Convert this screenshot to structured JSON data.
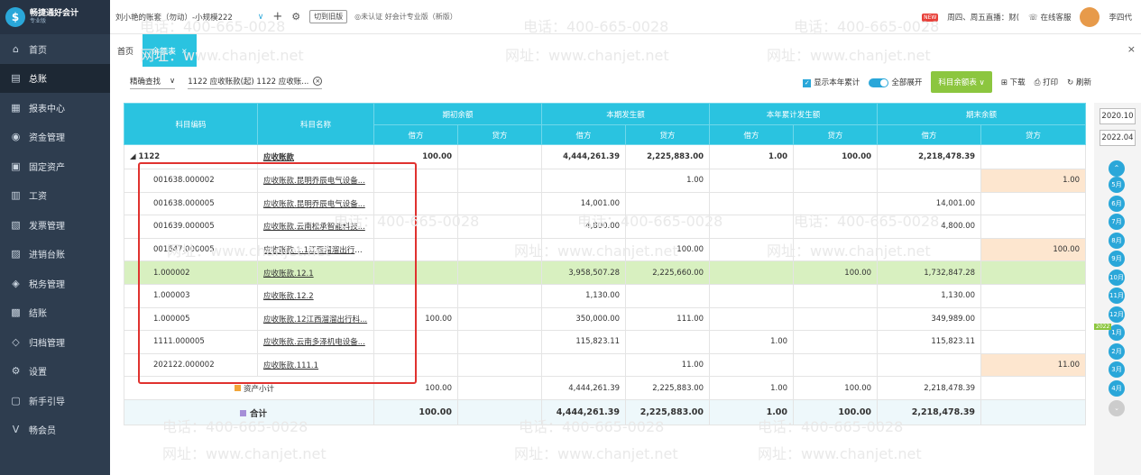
{
  "app": {
    "brand": "畅捷通好会计",
    "edition": "专业版"
  },
  "sidebar": {
    "items": [
      {
        "label": "首页",
        "icon": "home-icon",
        "glyph": "⌂"
      },
      {
        "label": "总账",
        "icon": "ledger-icon",
        "glyph": "▤",
        "active": true
      },
      {
        "label": "报表中心",
        "icon": "report-icon",
        "glyph": "▦"
      },
      {
        "label": "资金管理",
        "icon": "fund-icon",
        "glyph": "◉"
      },
      {
        "label": "固定资产",
        "icon": "asset-icon",
        "glyph": "▣"
      },
      {
        "label": "工资",
        "icon": "salary-icon",
        "glyph": "▥"
      },
      {
        "label": "发票管理",
        "icon": "invoice-icon",
        "glyph": "▧"
      },
      {
        "label": "进销台账",
        "icon": "inventory-icon",
        "glyph": "▨"
      },
      {
        "label": "税务管理",
        "icon": "tax-icon",
        "glyph": "◈"
      },
      {
        "label": "结账",
        "icon": "close-books-icon",
        "glyph": "▩"
      },
      {
        "label": "归档管理",
        "icon": "archive-icon",
        "glyph": "◇"
      },
      {
        "label": "设置",
        "icon": "gear-icon",
        "glyph": "⚙"
      },
      {
        "label": "新手引导",
        "icon": "guide-icon",
        "glyph": "▢"
      },
      {
        "label": "畅会员",
        "icon": "member-icon",
        "glyph": "V"
      }
    ]
  },
  "topbar": {
    "account": "刘小艳的账套（勿动）-小规模222",
    "switch_label": "切到旧版",
    "cert_note": "◎未认证 好会计专业版（新版）",
    "news_badge": "NEW",
    "promo": "周四、周五直播：财(",
    "service": "在线客服",
    "user": "李四代"
  },
  "tabs": {
    "home": "首页",
    "active": "余额表"
  },
  "toolbar": {
    "search_mode": "精确查找",
    "range": "1122 应收账款(起) 1122 应收账...",
    "show_year": "显示本年累计",
    "expand_all": "全部展开",
    "balance_btn": "科目余额表",
    "download": "下载",
    "print": "打印",
    "refresh": "刷新"
  },
  "table": {
    "headers": {
      "code": "科目编码",
      "name": "科目名称",
      "opening": "期初余额",
      "period": "本期发生额",
      "ytd": "本年累计发生额",
      "closing": "期末余额",
      "debit": "借方",
      "credit": "贷方"
    },
    "parent": {
      "code": "◢ 1122",
      "name": "应收账款",
      "o_d": "100.00",
      "o_c": "",
      "p_d": "4,444,261.39",
      "p_c": "2,225,883.00",
      "y_d": "1.00",
      "y_c": "100.00",
      "c_d": "2,218,478.39",
      "c_c": ""
    },
    "rows": [
      {
        "code": "001638.000002",
        "name": "应收账款.昆明乔辰电气设备...",
        "o_d": "",
        "o_c": "",
        "p_d": "",
        "p_c": "1.00",
        "y_d": "",
        "y_c": "",
        "c_d": "",
        "c_c": "1.00",
        "peach": true
      },
      {
        "code": "001638.000005",
        "name": "应收账款.昆明乔辰电气设备...",
        "o_d": "",
        "o_c": "",
        "p_d": "14,001.00",
        "p_c": "",
        "y_d": "",
        "y_c": "",
        "c_d": "14,001.00",
        "c_c": ""
      },
      {
        "code": "001639.000005",
        "name": "应收账款.云南松承智能科技...",
        "o_d": "",
        "o_c": "",
        "p_d": "4,800.00",
        "p_c": "",
        "y_d": "",
        "y_c": "",
        "c_d": "4,800.00",
        "c_c": ""
      },
      {
        "code": "001647.000005",
        "name": "应收账款.1.1江西溜溜出行科技...",
        "o_d": "",
        "o_c": "",
        "p_d": "",
        "p_c": "100.00",
        "y_d": "",
        "y_c": "",
        "c_d": "",
        "c_c": "100.00",
        "peach": true
      },
      {
        "code": "1.000002",
        "name": "应收账款.12.1",
        "o_d": "",
        "o_c": "",
        "p_d": "3,958,507.28",
        "p_c": "2,225,660.00",
        "y_d": "",
        "y_c": "100.00",
        "c_d": "1,732,847.28",
        "c_c": "",
        "green": true
      },
      {
        "code": "1.000003",
        "name": "应收账款.12.2",
        "o_d": "",
        "o_c": "",
        "p_d": "1,130.00",
        "p_c": "",
        "y_d": "",
        "y_c": "",
        "c_d": "1,130.00",
        "c_c": ""
      },
      {
        "code": "1.000005",
        "name": "应收账款.12江西溜溜出行科...",
        "o_d": "100.00",
        "o_c": "",
        "p_d": "350,000.00",
        "p_c": "111.00",
        "y_d": "",
        "y_c": "",
        "c_d": "349,989.00",
        "c_c": ""
      },
      {
        "code": "1111.000005",
        "name": "应收账款.云南多泽机电设备...",
        "o_d": "",
        "o_c": "",
        "p_d": "115,823.11",
        "p_c": "",
        "y_d": "1.00",
        "y_c": "",
        "c_d": "115,823.11",
        "c_c": ""
      },
      {
        "code": "202122.000002",
        "name": "应收账款.111.1",
        "o_d": "",
        "o_c": "",
        "p_d": "",
        "p_c": "11.00",
        "y_d": "",
        "y_c": "",
        "c_d": "",
        "c_c": "11.00",
        "peach": true
      }
    ],
    "subtotal": {
      "label": "资产小计",
      "o_d": "100.00",
      "o_c": "",
      "p_d": "4,444,261.39",
      "p_c": "2,225,883.00",
      "y_d": "1.00",
      "y_c": "100.00",
      "c_d": "2,218,478.39",
      "c_c": ""
    },
    "total": {
      "label": "合计",
      "o_d": "100.00",
      "o_c": "",
      "p_d": "4,444,261.39",
      "p_c": "2,225,883.00",
      "y_d": "1.00",
      "y_c": "100.00",
      "c_d": "2,218,478.39",
      "c_c": ""
    }
  },
  "rightpanel": {
    "date_from": "2020.10",
    "date_to": "2022.04",
    "year_tag": "2022",
    "months": [
      "5月",
      "6月",
      "7月",
      "8月",
      "9月",
      "10月",
      "11月",
      "12月",
      "1月",
      "2月",
      "3月",
      "4月"
    ]
  },
  "watermark": {
    "phone": "电话：400-665-0028",
    "site": "网址：www.chanjet.net"
  },
  "colors": {
    "accent": "#2ac3e0",
    "sidebar": "#2e3d4f",
    "highlight": "#d8f0c0",
    "credit_balance": "#fde6cf",
    "annotation": "#e0322f",
    "button": "#8cc63f"
  }
}
